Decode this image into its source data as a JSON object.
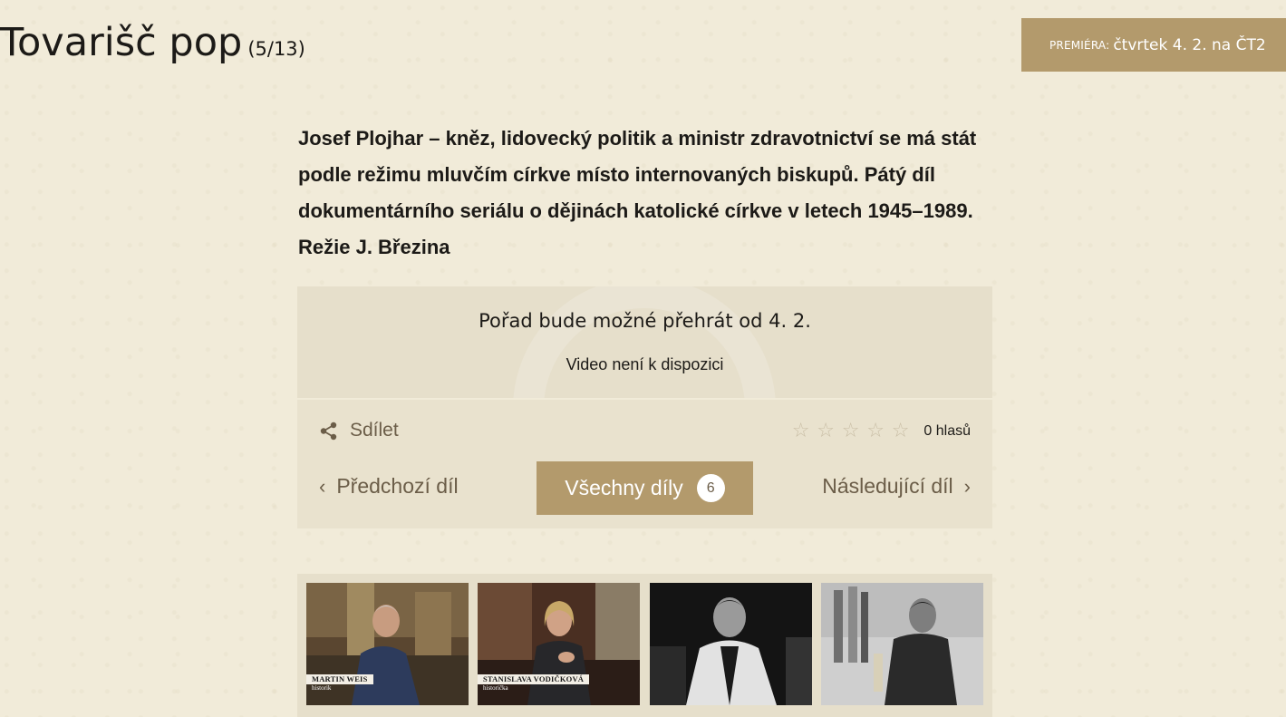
{
  "header": {
    "title": "Tovarišč pop",
    "episode_count": "(5/13)",
    "premiere_label": "PREMIÉRA:",
    "premiere_value": "čtvrtek 4. 2. na ČT2"
  },
  "description": "Josef Plojhar – kněz, lidovecký politik a ministr zdravotnictví se má stát podle režimu mluvčím církve místo internovaných biskupů. Pátý díl dokumentárního seriálu o dějinách katolické církve v letech 1945–1989. Režie J. Březina",
  "player": {
    "availability": "Pořad bude možné přehrát od 4. 2.",
    "status": "Video není k dispozici"
  },
  "actions": {
    "share_label": "Sdílet",
    "rating_stars": 5,
    "rating_value": 0,
    "votes": "0 hlasů",
    "prev_label": "Předchozí díl",
    "all_label": "Všechny díly",
    "all_count": "6",
    "next_label": "Následující díl"
  },
  "gallery": [
    {
      "caption_name": "MARTIN WEIS",
      "caption_role": "historik"
    },
    {
      "caption_name": "STANISLAVA VODIČKOVÁ",
      "caption_role": "historička"
    },
    {
      "caption_name": "",
      "caption_role": ""
    },
    {
      "caption_name": "",
      "caption_role": ""
    }
  ],
  "colors": {
    "background": "#f1ebd9",
    "accent": "#b39a6c",
    "panel": "#e6dfcb",
    "muted_text": "#6b5d48",
    "star_empty": "#c9bea6"
  },
  "icons": {
    "share": "share-icon",
    "star": "star-outline-icon",
    "prev": "chevron-left-icon",
    "next": "chevron-right-icon"
  }
}
